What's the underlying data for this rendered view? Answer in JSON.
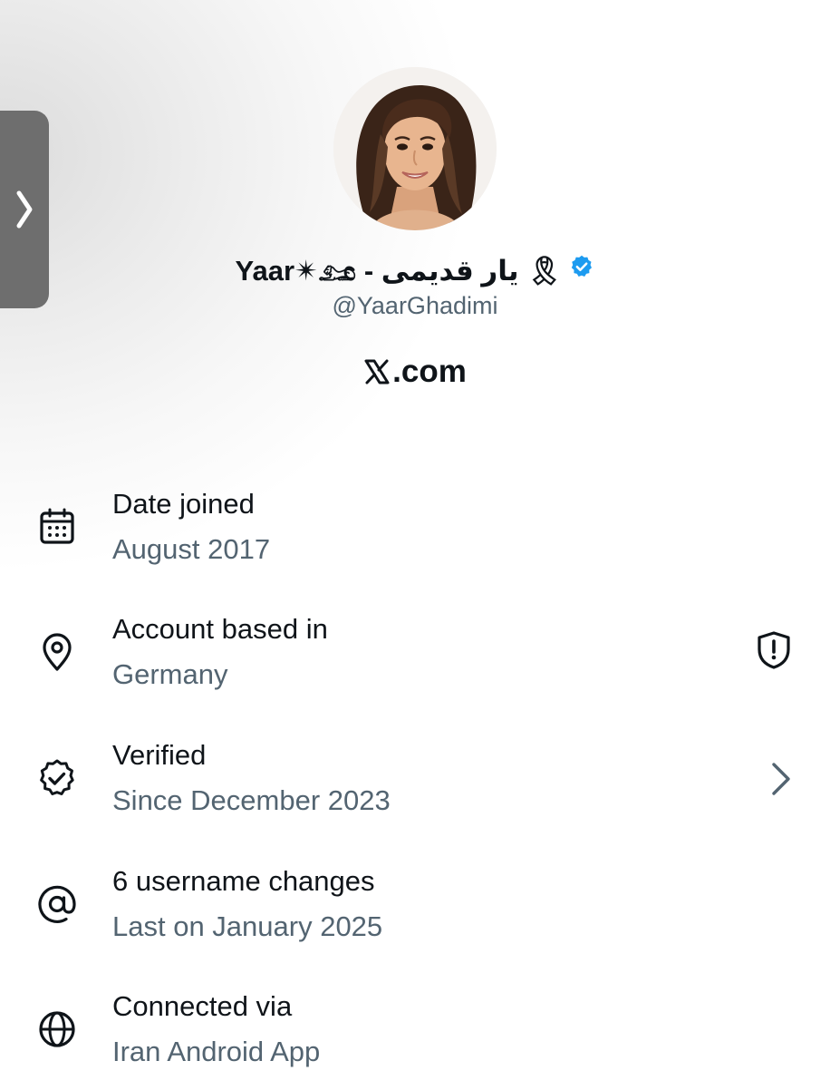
{
  "profile": {
    "display_name": "🎗 يار قديمى - Yaar✴𓃭",
    "handle": "@YaarGhadimi",
    "site_label": ".com"
  },
  "colors": {
    "verified_badge": "#1d9bf0",
    "secondary_text": "#536471",
    "primary_text": "#0f1419"
  },
  "about": [
    {
      "icon": "calendar-icon",
      "title": "Date joined",
      "subtitle": "August 2017"
    },
    {
      "icon": "location-pin-icon",
      "title": "Account based in",
      "subtitle": "Germany",
      "action_icon": "shield-alert-icon"
    },
    {
      "icon": "verified-icon",
      "title": "Verified",
      "subtitle": "Since December 2023",
      "action_icon": "chevron-right-icon"
    },
    {
      "icon": "at-sign-icon",
      "title": "6 username changes",
      "subtitle": "Last on January 2025"
    },
    {
      "icon": "globe-icon",
      "title": "Connected via",
      "subtitle": "Iran Android App"
    }
  ]
}
